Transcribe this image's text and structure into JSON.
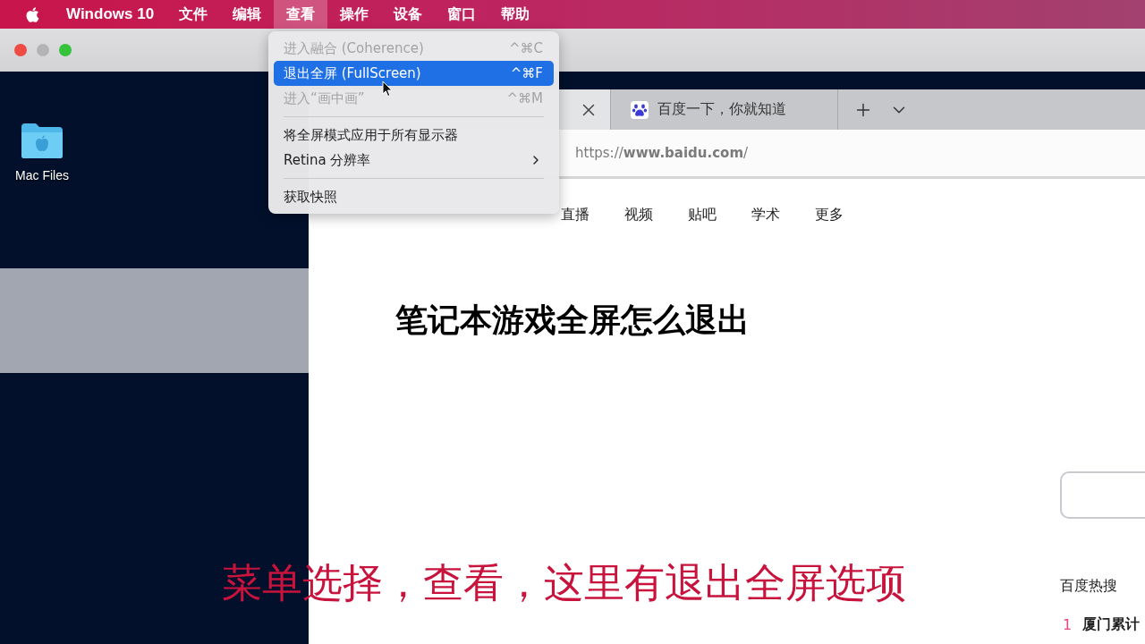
{
  "menu_bar": {
    "items": [
      {
        "label": "Windows 10",
        "kind": "app",
        "selected": false
      },
      {
        "label": "文件",
        "kind": "menu",
        "selected": false
      },
      {
        "label": "编辑",
        "kind": "menu",
        "selected": false
      },
      {
        "label": "查看",
        "kind": "menu",
        "selected": true
      },
      {
        "label": "操作",
        "kind": "menu",
        "selected": false
      },
      {
        "label": "设备",
        "kind": "menu",
        "selected": false
      },
      {
        "label": "窗口",
        "kind": "menu",
        "selected": false
      },
      {
        "label": "帮助",
        "kind": "menu",
        "selected": false
      }
    ]
  },
  "desktop": {
    "icons": [
      {
        "label": "Mac Files"
      }
    ]
  },
  "browser": {
    "tabs": [
      {
        "selected": true
      },
      {
        "title": "百度一下，你就知道",
        "selected": false
      }
    ],
    "address": "https://**www.baidu.com**/",
    "nav_links": [
      "直播",
      "视频",
      "贴吧",
      "学术",
      "更多"
    ],
    "hot_search": {
      "title": "百度热搜",
      "items": [
        {
          "rank": "1",
          "text": "厦门累计"
        }
      ]
    }
  },
  "dropdown_menu": {
    "items": [
      {
        "kind": "item",
        "label": "进入融合 (Coherence)",
        "shortcut": "^⌘C",
        "disabled": true,
        "selected": false,
        "submenu": false
      },
      {
        "kind": "item",
        "label": "退出全屏 (FullScreen)",
        "shortcut": "^⌘F",
        "disabled": false,
        "selected": true,
        "submenu": false
      },
      {
        "kind": "item",
        "label": "进入“画中画”",
        "shortcut": "^⌘M",
        "disabled": true,
        "selected": false,
        "submenu": false
      },
      {
        "kind": "separator"
      },
      {
        "kind": "item",
        "label": "将全屏模式应用于所有显示器",
        "disabled": false,
        "selected": false,
        "submenu": false
      },
      {
        "kind": "item",
        "label": "Retina 分辨率",
        "disabled": false,
        "selected": false,
        "submenu": true
      },
      {
        "kind": "separator"
      },
      {
        "kind": "item",
        "label": "获取快照",
        "disabled": false,
        "selected": false,
        "submenu": false
      }
    ]
  },
  "caption": {
    "title": "笔记本游戏全屏怎么退出",
    "subtitle": "菜单选择，查看，这里有退出全屏选项"
  }
}
